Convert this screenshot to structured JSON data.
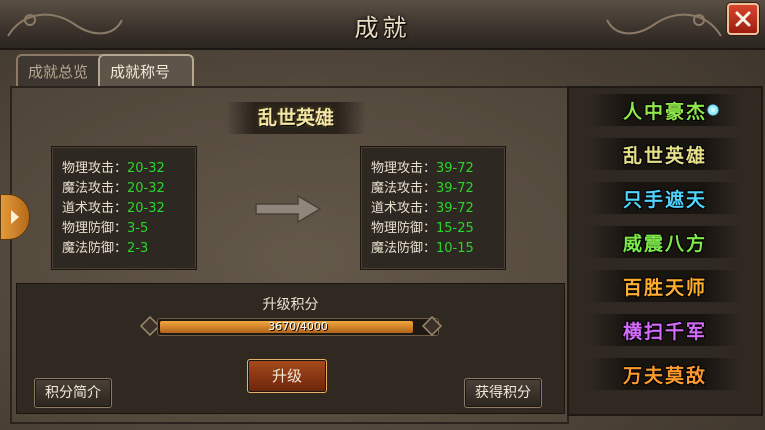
{
  "window": {
    "title": "成就"
  },
  "tabs": [
    {
      "label": "成就总览",
      "active": false
    },
    {
      "label": "成就称号",
      "active": true
    }
  ],
  "current_title": "乱世英雄",
  "current_stats": [
    {
      "label": "物理攻击：",
      "value": "20-32"
    },
    {
      "label": "魔法攻击：",
      "value": "20-32"
    },
    {
      "label": "道术攻击：",
      "value": "20-32"
    },
    {
      "label": "物理防御：",
      "value": "3-5"
    },
    {
      "label": "魔法防御：",
      "value": "2-3"
    }
  ],
  "next_stats": [
    {
      "label": "物理攻击：",
      "value": "39-72"
    },
    {
      "label": "魔法攻击：",
      "value": "39-72"
    },
    {
      "label": "道术攻击：",
      "value": "39-72"
    },
    {
      "label": "物理防御：",
      "value": "15-25"
    },
    {
      "label": "魔法防御：",
      "value": "10-15"
    }
  ],
  "upgrade": {
    "label": "升级积分",
    "progress_text": "3670/4000",
    "progress_fraction": 0.9175,
    "upgrade_button": "升级",
    "points_info_button": "积分简介",
    "get_points_button": "获得积分"
  },
  "title_list": [
    {
      "name": "人中豪杰",
      "color": "#8fe84a",
      "selected": true
    },
    {
      "name": "乱世英雄",
      "color": "#e6e08a",
      "selected": false
    },
    {
      "name": "只手遮天",
      "color": "#4fd3ff",
      "selected": false
    },
    {
      "name": "威震八方",
      "color": "#7de84a",
      "selected": false
    },
    {
      "name": "百胜天师",
      "color": "#ffae2e",
      "selected": false
    },
    {
      "name": "横扫千军",
      "color": "#d66bff",
      "selected": false
    },
    {
      "name": "万夫莫敌",
      "color": "#ff9a2e",
      "selected": false
    }
  ],
  "colors": {
    "stat_value": "#2bd52b",
    "accent": "#e39a3c"
  }
}
